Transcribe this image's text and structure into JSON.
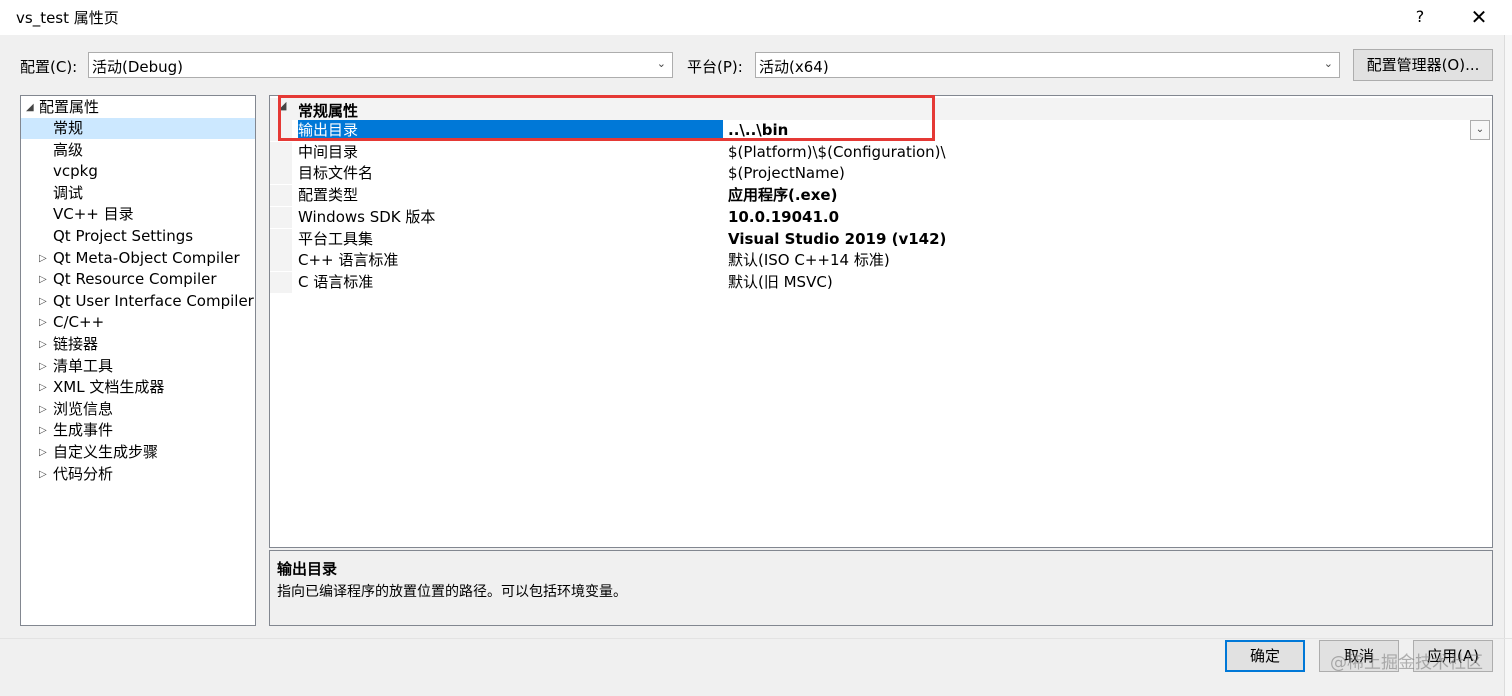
{
  "window": {
    "title": "vs_test 属性页",
    "help": "?",
    "close": "✕"
  },
  "toolbar": {
    "config_label": "配置(C):",
    "config_value": "活动(Debug)",
    "platform_label": "平台(P):",
    "platform_value": "活动(x64)",
    "config_manager_label": "配置管理器(O)..."
  },
  "tree": {
    "root": "配置属性",
    "items": [
      {
        "label": "常规",
        "expandable": false,
        "selected": true
      },
      {
        "label": "高级",
        "expandable": false
      },
      {
        "label": "vcpkg",
        "expandable": false
      },
      {
        "label": "调试",
        "expandable": false
      },
      {
        "label": "VC++ 目录",
        "expandable": false
      },
      {
        "label": "Qt Project Settings",
        "expandable": false
      },
      {
        "label": "Qt Meta-Object Compiler",
        "expandable": true
      },
      {
        "label": "Qt Resource Compiler",
        "expandable": true
      },
      {
        "label": "Qt User Interface Compiler",
        "expandable": true
      },
      {
        "label": "C/C++",
        "expandable": true
      },
      {
        "label": "链接器",
        "expandable": true
      },
      {
        "label": "清单工具",
        "expandable": true
      },
      {
        "label": "XML 文档生成器",
        "expandable": true
      },
      {
        "label": "浏览信息",
        "expandable": true
      },
      {
        "label": "生成事件",
        "expandable": true
      },
      {
        "label": "自定义生成步骤",
        "expandable": true
      },
      {
        "label": "代码分析",
        "expandable": true
      }
    ]
  },
  "grid": {
    "category": "常规属性",
    "rows": [
      {
        "name": "输出目录",
        "value": "..\\..\\bin",
        "bold": true,
        "selected": true
      },
      {
        "name": "中间目录",
        "value": "$(Platform)\\$(Configuration)\\",
        "bold": false
      },
      {
        "name": "目标文件名",
        "value": "$(ProjectName)",
        "bold": false
      },
      {
        "name": "配置类型",
        "value": "应用程序(.exe)",
        "bold": true
      },
      {
        "name": "Windows SDK 版本",
        "value": "10.0.19041.0",
        "bold": true
      },
      {
        "name": "平台工具集",
        "value": "Visual Studio 2019 (v142)",
        "bold": true
      },
      {
        "name": "C++ 语言标准",
        "value": "默认(ISO C++14 标准)",
        "bold": false
      },
      {
        "name": "C 语言标准",
        "value": "默认(旧 MSVC)",
        "bold": false
      }
    ]
  },
  "description": {
    "title": "输出目录",
    "text": "指向已编译程序的放置位置的路径。可以包括环境变量。"
  },
  "buttons": {
    "ok": "确定",
    "cancel": "取消",
    "apply": "应用(A)"
  },
  "watermark": "@稀土掘金技术社区",
  "colors": {
    "accent": "#0078d7",
    "highlight_box": "#e53935",
    "tree_selection": "#cce8ff"
  }
}
